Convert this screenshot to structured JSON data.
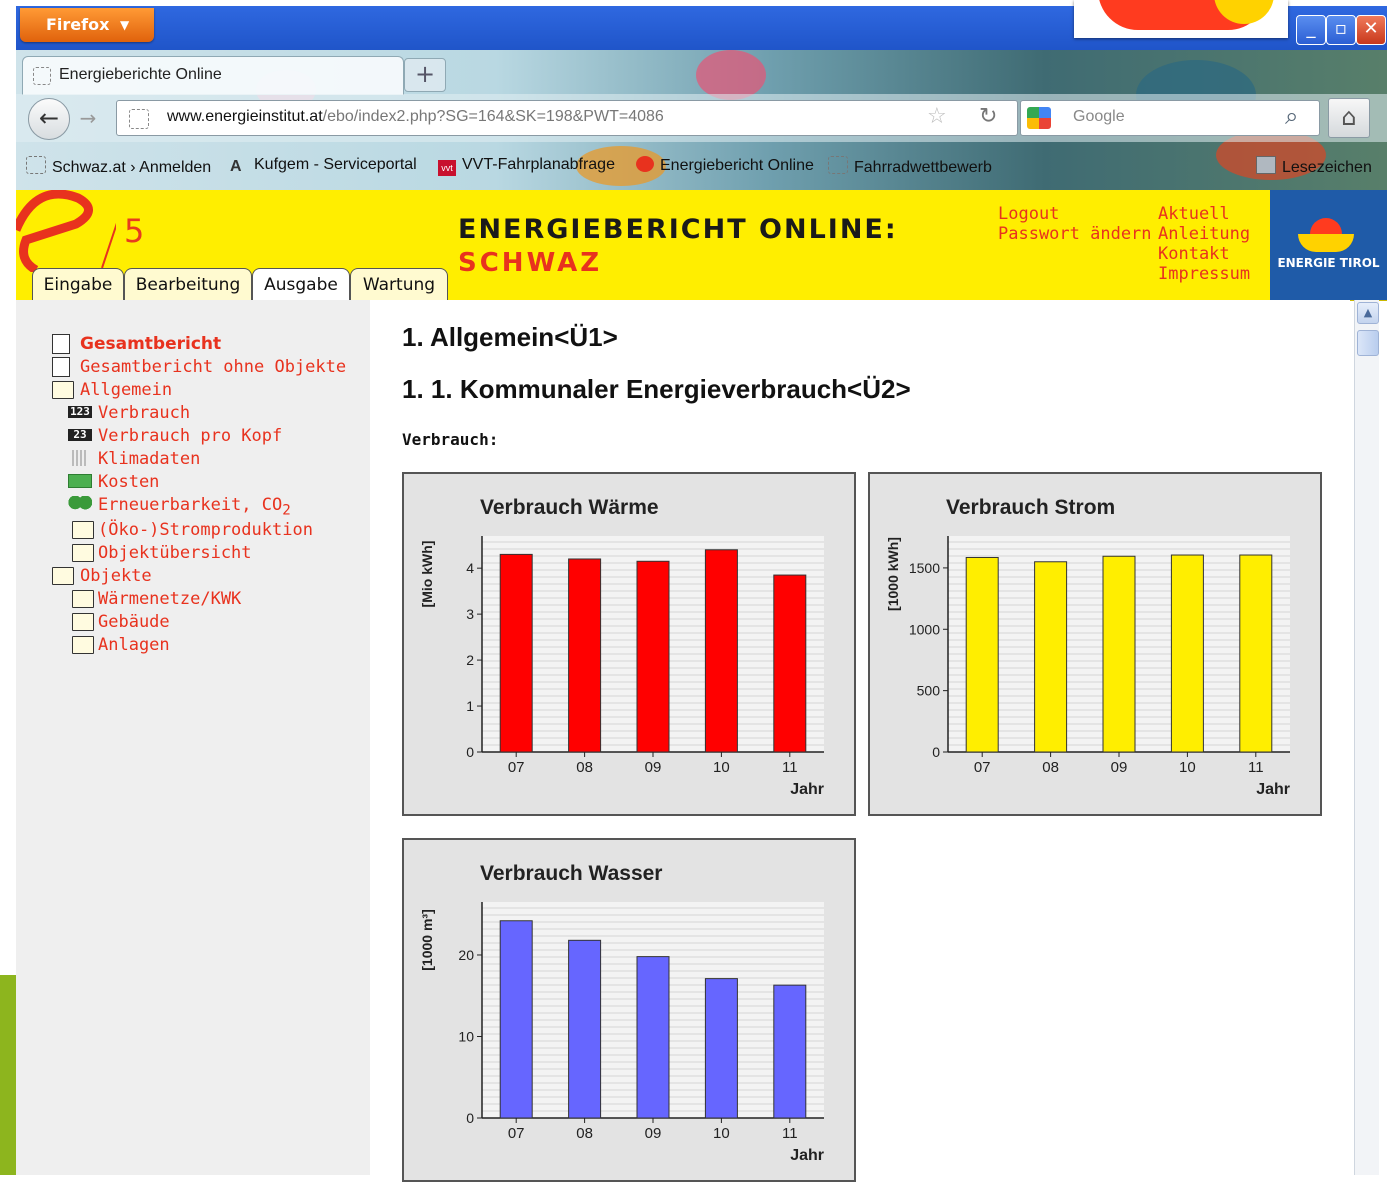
{
  "browser": {
    "app_button": "Firefox",
    "tab_title": "Energieberichte Online",
    "new_tab": "+",
    "url_domain": "www.energieinstitut.at",
    "url_path": "/ebo/index2.php?SG=164&SK=198&PWT=4086",
    "search_placeholder": "Google",
    "bookmarks": [
      "Schwaz.at › Anmelden",
      "Kufgem - Serviceportal",
      "VVT-Fahrplanabfrage",
      "Energiebericht Online",
      "Fahrradwettbewerb",
      "Lesezeichen"
    ]
  },
  "header": {
    "logo_number": "5",
    "title": "ENERGIEBERICHT ONLINE:",
    "subtitle": "SCHWAZ",
    "links_left": [
      "Logout",
      "Passwort ändern"
    ],
    "links_right": [
      "Aktuell",
      "Anleitung",
      "Kontakt",
      "Impressum"
    ],
    "partner_logo": "ENERGIE TIROL",
    "tabs": [
      "Eingabe",
      "Bearbeitung",
      "Ausgabe",
      "Wartung"
    ]
  },
  "sidebar": {
    "items": [
      {
        "label": "Gesamtbericht",
        "icon": "report-icon"
      },
      {
        "label": "Gesamtbericht ohne Objekte",
        "icon": "report-icon"
      },
      {
        "label": "Allgemein",
        "icon": "folder-open-icon"
      },
      {
        "label": "Verbrauch",
        "icon": "counter-icon"
      },
      {
        "label": "Verbrauch pro Kopf",
        "icon": "counter-person-icon"
      },
      {
        "label": "Klimadaten",
        "icon": "climate-icon"
      },
      {
        "label": "Kosten",
        "icon": "money-icon"
      },
      {
        "label": "Erneuerbarkeit, CO",
        "sub": "2",
        "icon": "trees-icon"
      },
      {
        "label": "(Öko-)Stromproduktion",
        "icon": "folder-icon"
      },
      {
        "label": "Objektübersicht",
        "icon": "folder-icon"
      },
      {
        "label": "Objekte",
        "icon": "folder-open-icon"
      },
      {
        "label": "Wärmenetze/KWK",
        "icon": "folder-icon"
      },
      {
        "label": "Gebäude",
        "icon": "folder-icon"
      },
      {
        "label": "Anlagen",
        "icon": "folder-icon"
      }
    ]
  },
  "main": {
    "heading1": "1. Allgemein<Ü1>",
    "heading2": "1. 1. Kommunaler Energieverbrauch<Ü2>",
    "section_label": "Verbrauch:"
  },
  "chart_data": [
    {
      "type": "bar",
      "title": "Verbrauch Wärme",
      "ylabel": "[Mio kWh]",
      "xlabel": "Jahr",
      "categories": [
        "07",
        "08",
        "09",
        "10",
        "11"
      ],
      "values": [
        4.3,
        4.2,
        4.15,
        4.4,
        3.85
      ],
      "ylim": [
        0,
        4.7
      ],
      "yticks": [
        0,
        1,
        2,
        3,
        4
      ],
      "color": "#ff0000",
      "grid": true
    },
    {
      "type": "bar",
      "title": "Verbrauch Strom",
      "ylabel": "[1000 kWh]",
      "xlabel": "Jahr",
      "categories": [
        "07",
        "08",
        "09",
        "10",
        "11"
      ],
      "values": [
        1585,
        1550,
        1595,
        1605,
        1605
      ],
      "ylim": [
        0,
        1760
      ],
      "yticks": [
        0,
        500,
        1000,
        1500
      ],
      "color": "#ffee00",
      "grid": true
    },
    {
      "type": "bar",
      "title": "Verbrauch Wasser",
      "ylabel": "[1000 m³]",
      "xlabel": "Jahr",
      "categories": [
        "07",
        "08",
        "09",
        "10",
        "11"
      ],
      "values": [
        24.2,
        21.8,
        19.8,
        17.1,
        16.3
      ],
      "ylim": [
        0,
        26.5
      ],
      "yticks": [
        0,
        10,
        20
      ],
      "color": "#6666ff",
      "grid": true
    }
  ]
}
